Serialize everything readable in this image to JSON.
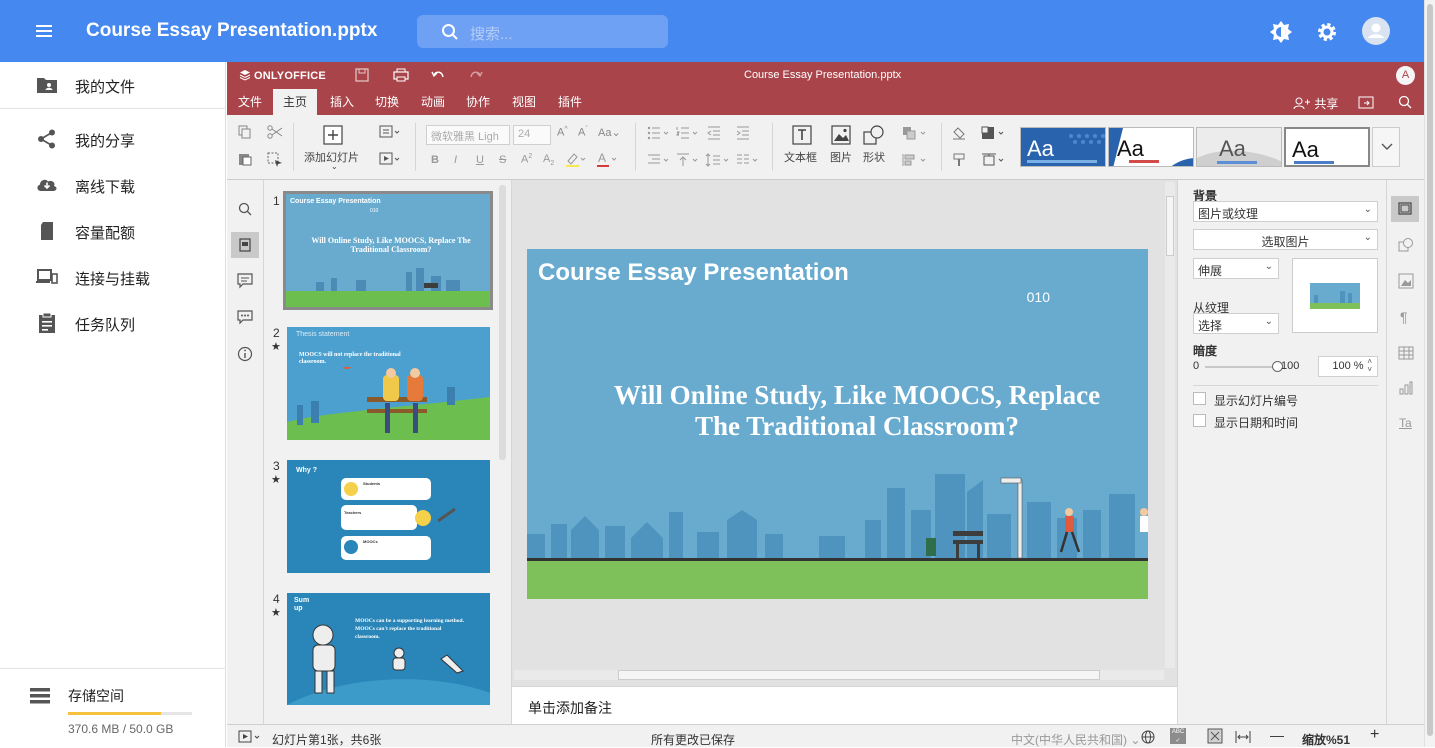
{
  "app": {
    "title": "Course Essay Presentation.pptx",
    "search_placeholder": "搜索..."
  },
  "sidebar": {
    "items": [
      {
        "label": "我的文件",
        "icon": "folder-user-icon"
      },
      {
        "label": "我的分享",
        "icon": "share-icon"
      },
      {
        "label": "离线下载",
        "icon": "cloud-download-icon"
      },
      {
        "label": "容量配额",
        "icon": "sd-card-icon"
      },
      {
        "label": "连接与挂载",
        "icon": "devices-icon"
      },
      {
        "label": "任务队列",
        "icon": "clipboard-icon"
      }
    ],
    "storage": {
      "label": "存储空间",
      "info": "370.6 MB / 50.0 GB",
      "used_fraction": 0.75
    }
  },
  "editor": {
    "brand": "ONLYOFFICE",
    "file_title": "Course Essay Presentation.pptx",
    "avatar": "A",
    "tabs": [
      "文件",
      "主页",
      "插入",
      "切换",
      "动画",
      "协作",
      "视图",
      "插件"
    ],
    "active_tab": 1,
    "share": "共享",
    "toolbar": {
      "add_slide": "添加幻灯片",
      "font_name": "微软雅黑 Ligh",
      "font_size": "24",
      "textbox": "文本框",
      "image": "图片",
      "shape": "形状",
      "format_buttons": [
        "B",
        "I",
        "U",
        "S"
      ],
      "themes": [
        "Aa",
        "Aa",
        "Aa",
        "Aa"
      ]
    },
    "thumbnails": [
      {
        "num": "1",
        "title": "Course Essay Presentation",
        "sub": "010",
        "body": "Will Online Study, Like MOOCS, Replace The Traditional Classroom?"
      },
      {
        "num": "2",
        "title": "Thesis statement",
        "body": "MOOCS will not replace the traditional classroom."
      },
      {
        "num": "3",
        "title": "Why ?",
        "items": [
          "Students",
          "Teachers",
          "MOOCs"
        ]
      },
      {
        "num": "4",
        "title": "Sum up",
        "body": "MOOCs can be a supporting learning method. MOOCs can't replace the traditional classroom."
      }
    ],
    "slide": {
      "title": "Course Essay Presentation",
      "subtitle": "010",
      "body_line1": "Will Online Study,  Like MOOCS,  Replace",
      "body_line2": "The Traditional Classroom?"
    },
    "notes_placeholder": "单击添加备注",
    "settings": {
      "background_label": "背景",
      "fill_type": "图片或纹理",
      "select_image": "选取图片",
      "stretch": "伸展",
      "from_texture_label": "从纹理",
      "select": "选择",
      "transparency_label": "暗度",
      "slider_min": "0",
      "slider_max": "100",
      "slider_value": 100,
      "opacity_value": "100 %",
      "show_slide_number": "显示幻灯片编号",
      "show_date_time": "显示日期和时间"
    },
    "status": {
      "slide_info": "幻灯片第1张，共6张",
      "save_state": "所有更改已保存",
      "language": "中文(中华人民共和国)",
      "zoom": "缩放%51"
    }
  }
}
